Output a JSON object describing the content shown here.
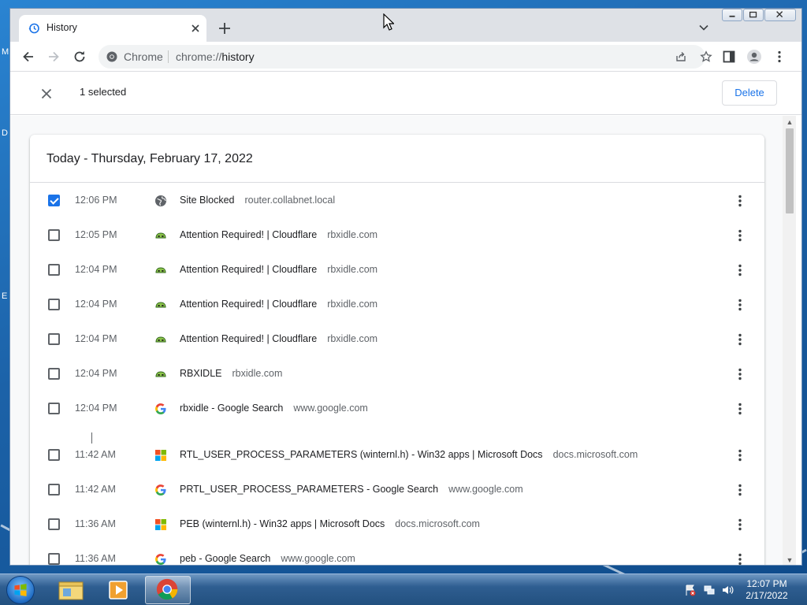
{
  "browser": {
    "tab_title": "History",
    "omnibox_label": "Chrome",
    "url_prefix": "chrome://",
    "url_path": "history"
  },
  "selection": {
    "count_label": "1 selected",
    "delete_label": "Delete"
  },
  "history": {
    "date_header": "Today - Thursday, February 17, 2022",
    "entries": [
      {
        "time": "12:06 PM",
        "title": "Site Blocked",
        "domain": "router.collabnet.local",
        "favicon": "globe-icon",
        "checked": true
      },
      {
        "time": "12:05 PM",
        "title": "Attention Required! | Cloudflare",
        "domain": "rbxidle.com",
        "favicon": "rbxidle-icon",
        "checked": false
      },
      {
        "time": "12:04 PM",
        "title": "Attention Required! | Cloudflare",
        "domain": "rbxidle.com",
        "favicon": "rbxidle-icon",
        "checked": false
      },
      {
        "time": "12:04 PM",
        "title": "Attention Required! | Cloudflare",
        "domain": "rbxidle.com",
        "favicon": "rbxidle-icon",
        "checked": false
      },
      {
        "time": "12:04 PM",
        "title": "Attention Required! | Cloudflare",
        "domain": "rbxidle.com",
        "favicon": "rbxidle-icon",
        "checked": false
      },
      {
        "time": "12:04 PM",
        "title": "RBXIDLE",
        "domain": "rbxidle.com",
        "favicon": "rbxidle-icon",
        "checked": false
      },
      {
        "time": "12:04 PM",
        "title": "rbxidle - Google Search",
        "domain": "www.google.com",
        "favicon": "google-icon",
        "checked": false
      },
      {
        "time": "11:42 AM",
        "title": "RTL_USER_PROCESS_PARAMETERS (winternl.h) - Win32 apps | Microsoft Docs",
        "domain": "docs.microsoft.com",
        "favicon": "microsoft-icon",
        "checked": false
      },
      {
        "time": "11:42 AM",
        "title": "PRTL_USER_PROCESS_PARAMETERS - Google Search",
        "domain": "www.google.com",
        "favicon": "google-icon",
        "checked": false
      },
      {
        "time": "11:36 AM",
        "title": "PEB (winternl.h) - Win32 apps | Microsoft Docs",
        "domain": "docs.microsoft.com",
        "favicon": "microsoft-icon",
        "checked": false
      },
      {
        "time": "11:36 AM",
        "title": "peb - Google Search",
        "domain": "www.google.com",
        "favicon": "google-icon",
        "checked": false
      }
    ]
  },
  "desktop": {
    "edge_letters": [
      "M",
      "D",
      "E"
    ]
  },
  "taskbar": {
    "clock_time": "12:07 PM",
    "clock_date": "2/17/2022"
  },
  "colors": {
    "accent": "#1a73e8",
    "rbxidle_green": "#8bc34a"
  }
}
